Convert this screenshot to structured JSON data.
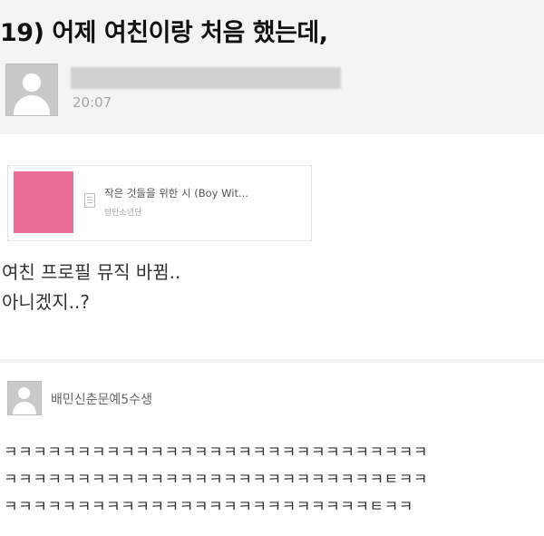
{
  "post": {
    "title": "19) 어제 여친이랑 처음 했는데,",
    "time": "20:07"
  },
  "music": {
    "song_title": "작은 것들을 위한 시 (Boy Wit...",
    "artist": "방탄소년단",
    "album_color": "#ea6f96"
  },
  "body": {
    "line1": "여친 프로필 뮤직 바뀜..",
    "line2": "아니겠지..?"
  },
  "comment": {
    "author": "배민신춘문예5수생",
    "line1": "ㅋㅋㅋㅋㅋㅋㅋㅋㅋㅋㅋㅋㅋㅋㅋㅋㅋㅋㅋㅋㅋㅋㅋㅋㅋㅋㅋㅋㅋ",
    "line2": "ㅋㅋㅋㅋㅋㅋㅋㅋㅋㅋㅋㅋㅋㅋㅋㅋㅋㅋㅋㅋㅋㅋㅋㅋㅋㅋㅌㅋㅋ",
    "line3": "ㅋㅋㅋㅋㅋㅋㅋㅋㅋㅋㅋㅋㅋㅋㅋㅋㅋㅋㅋㅋㅋㅋㅋㅋㅋㅌㅋㅋ"
  },
  "icons": {
    "avatar": "user-avatar-icon",
    "music_note": "document-list-icon"
  }
}
